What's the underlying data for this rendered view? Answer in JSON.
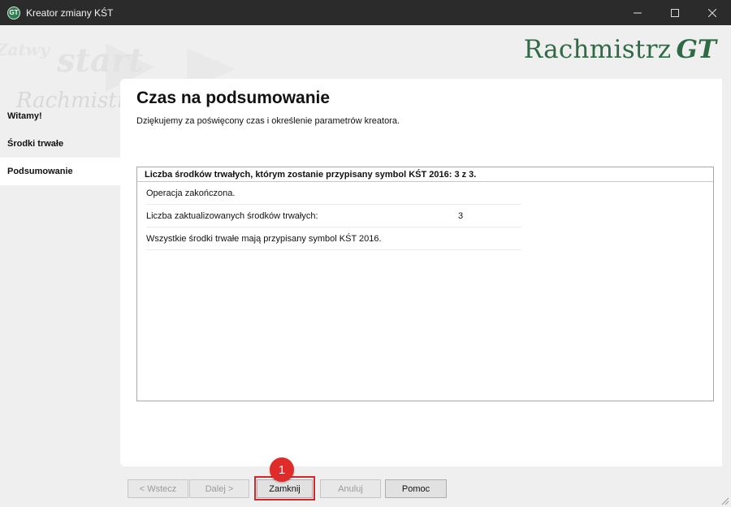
{
  "window": {
    "title": "Kreator zmiany KŚT",
    "icon_label": "GT",
    "controls": [
      "minimize-icon",
      "maximize-icon",
      "close-icon"
    ]
  },
  "header": {
    "watermark": [
      "Zatwy",
      "start",
      "Rachmistrz"
    ],
    "logo_main": "Rachmistrz",
    "logo_gt": "GT"
  },
  "sidebar": {
    "items": [
      {
        "label": "Witamy!",
        "active": false
      },
      {
        "label": "Środki trwałe",
        "active": false
      },
      {
        "label": "Podsumowanie",
        "active": true
      }
    ]
  },
  "main": {
    "title": "Czas na podsumowanie",
    "subtitle": "Dziękujemy za poświęcony czas i określenie parametrów kreatora.",
    "summary": {
      "header": "Liczba środków trwałych, którym zostanie przypisany symbol KŚT 2016:  3 z 3.",
      "rows": [
        {
          "label": "Operacja zakończona.",
          "value": ""
        },
        {
          "label": "Liczba zaktualizowanych środków trwałych:",
          "value": "3"
        },
        {
          "label": "Wszystkie środki trwałe mają przypisany symbol KŚT 2016.",
          "value": ""
        }
      ]
    }
  },
  "buttons": {
    "back": "< Wstecz",
    "next": "Dalej >",
    "close": "Zamknij",
    "cancel": "Anuluj",
    "help": "Pomoc"
  },
  "annotation": {
    "badge": "1",
    "color": "#e02b2b"
  },
  "colors": {
    "brand_green": "#2e6b45",
    "titlebar": "#2b2b2b"
  }
}
